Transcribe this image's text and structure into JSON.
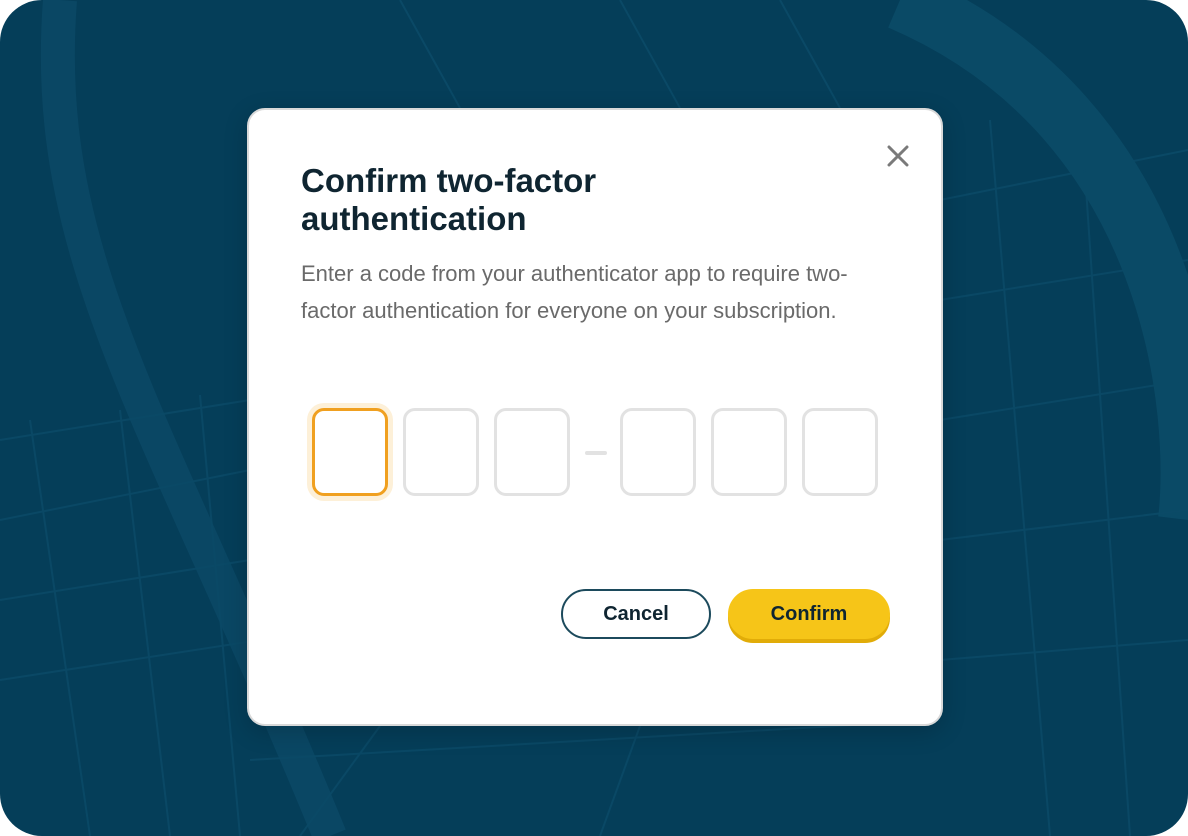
{
  "dialog": {
    "title": "Confirm two-factor authentication",
    "description": "Enter a code from your authenticator app to require two-factor authentication for everyone on your subscription.",
    "close_icon": "close-icon",
    "code": {
      "digits": [
        "",
        "",
        "",
        "",
        "",
        ""
      ],
      "separator": "–",
      "active_index": 0
    },
    "buttons": {
      "cancel_label": "Cancel",
      "confirm_label": "Confirm"
    }
  },
  "colors": {
    "background": "#053e59",
    "accent": "#f6c518",
    "focus": "#f0a020",
    "cancel_border": "#1c4a5c"
  }
}
